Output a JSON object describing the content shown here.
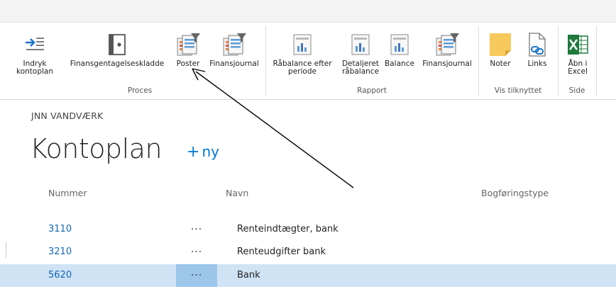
{
  "ribbon": {
    "buttons": [
      {
        "label": "Indryk kontoplan",
        "icon": "indent-list-icon"
      },
      {
        "label": "Finansgentagelseskladde",
        "icon": "book-icon"
      },
      {
        "label": "Poster",
        "icon": "filter-report-icon"
      },
      {
        "label": "Finansjournal",
        "icon": "filter-report-icon"
      },
      {
        "label": "Råbalance efter periode",
        "icon": "chart-report-icon"
      },
      {
        "label": "Detaljeret råbalance",
        "icon": "chart-report-icon"
      },
      {
        "label": "Balance",
        "icon": "chart-report-icon"
      },
      {
        "label": "Finansjournal",
        "icon": "filter-report-icon"
      },
      {
        "label": "Noter",
        "icon": "sticky-note-icon"
      },
      {
        "label": "Links",
        "icon": "link-document-icon"
      },
      {
        "label": "Åbn i Excel",
        "icon": "excel-icon"
      }
    ],
    "groups": [
      "Proces",
      "Rapport",
      "Vis tilknyttet",
      "Side"
    ]
  },
  "page": {
    "company": "JNN VANDVÆRK",
    "title": "Kontoplan",
    "new_label": "ny"
  },
  "table": {
    "headers": [
      "Nummer",
      "Navn",
      "Bogføringstype"
    ],
    "rows": [
      {
        "number": "3110",
        "dots": "···",
        "name": "Renteindtægter, bank",
        "selected": false
      },
      {
        "number": "3210",
        "dots": "···",
        "name": "Renteudgifter bank",
        "selected": false
      },
      {
        "number": "5620",
        "dots": "···",
        "name": "Bank",
        "selected": true
      }
    ]
  },
  "colors": {
    "accent": "#0078d7",
    "selected_row": "#cfe3f5",
    "excel_green": "#1f7a3c",
    "note_yellow": "#f7c95c"
  }
}
